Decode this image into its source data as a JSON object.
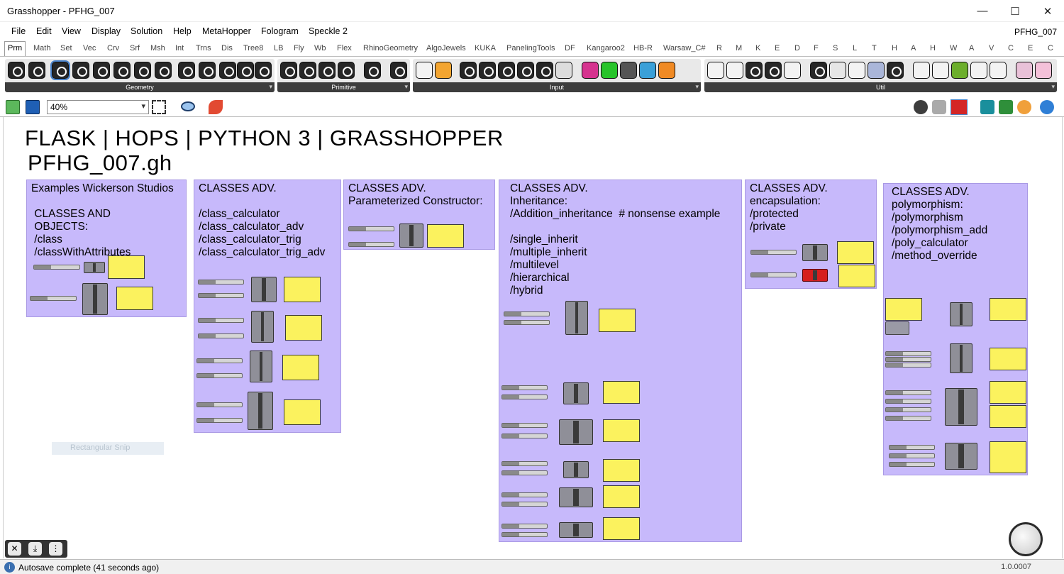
{
  "window": {
    "title": "Grasshopper - PFHG_007",
    "file_label": "PFHG_007",
    "minimize": "—",
    "maximize": "☐",
    "close": "✕"
  },
  "menu": [
    "File",
    "Edit",
    "View",
    "Display",
    "Solution",
    "Help",
    "MetaHopper",
    "Fologram",
    "Speckle 2"
  ],
  "tabs": [
    "Prm",
    "Math",
    "Set",
    "Vec",
    "Crv",
    "Srf",
    "Msh",
    "Int",
    "Trns",
    "Dis",
    "Tree8",
    "LB",
    "Fly",
    "Wb",
    "Flex",
    "RhinoGeometry",
    "AlgoJewels",
    "KUKA",
    "PanelingTools",
    "DF",
    "Kangaroo2",
    "HB-R",
    "Warsaw_C#",
    "R",
    "M",
    "K",
    "E",
    "D",
    "F",
    "S",
    "L",
    "T",
    "H",
    "A",
    "H",
    "W",
    "A",
    "V",
    "C",
    "E",
    "C"
  ],
  "ribbon_groups": [
    "Geometry",
    "Primitive",
    "Input",
    "Util"
  ],
  "zoom": "40%",
  "canvas": {
    "heading": "FLASK | HOPS | PYTHON 3 | GRASSHOPPER",
    "subheading": "PFHG_007.gh",
    "groups": [
      "Examples Wickerson Studios\n\n CLASSES AND\n OBJECTS:\n /class\n /classWithAttributes",
      "CLASSES ADV.\n\n/class_calculator\n/class_calculator_adv\n/class_calculator_trig\n/class_calculator_trig_adv",
      "CLASSES ADV.\nParameterized Constructor:",
      "CLASSES ADV.\nInheritance:\n/Addition_inheritance  # nonsense example\n\n/single_inherit\n/multiple_inherit\n/multilevel\n/hierarchical\n/hybrid",
      "CLASSES ADV.\nencapsulation:\n/protected\n/private",
      "CLASSES ADV.\npolymorphism:\n/polymorphism\n/polymorphism_add\n/poly_calculator\n/method_override"
    ],
    "snip_label": "Rectangular Snip"
  },
  "status": {
    "text": "Autosave complete (41 seconds ago)",
    "version": "1.0.0007"
  }
}
